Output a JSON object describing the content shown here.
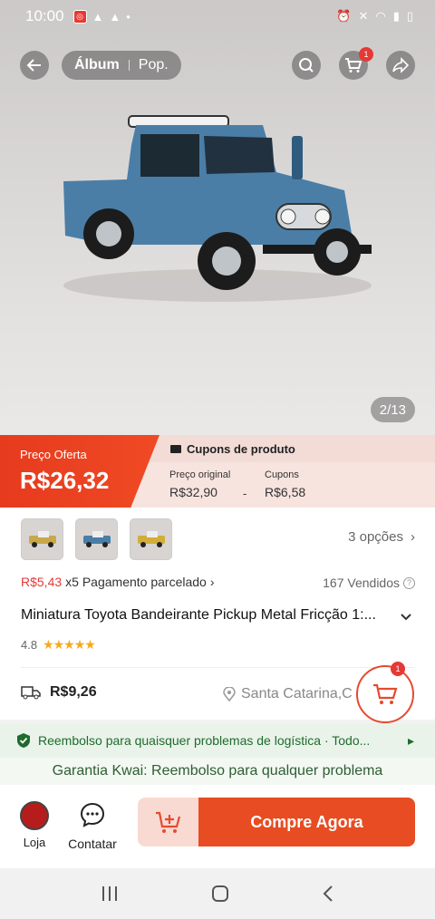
{
  "status_bar": {
    "time": "10:00"
  },
  "header": {
    "tabs": [
      {
        "label": "Álbum"
      },
      {
        "label": "Pop."
      }
    ],
    "cart_badge": "1",
    "image_counter": "2/13"
  },
  "price": {
    "offer_label": "Preço Oferta",
    "offer_value": "R$26,32",
    "coupons_title": "Cupons de produto",
    "original_label": "Preço original",
    "original_value": "R$32,90",
    "separator": "-",
    "coupon_label": "Cupons",
    "coupon_value": "R$6,58"
  },
  "product": {
    "options_label": "3 opções",
    "installment_amount": "R$5,43",
    "installment_text": "x5 Pagamento parcelado",
    "sold": "167 Vendidos",
    "title": "Miniatura Toyota Bandeirante Pickup Metal Fricção 1:...",
    "rating": "4.8",
    "stars": "★★★★★",
    "shipping_price": "R$9,26",
    "location": "Santa Catarina,C"
  },
  "float_cart_badge": "1",
  "guarantee": {
    "refund_text": "Reembolso para quaisquer problemas de logística · Todo...",
    "kwai_text": "Garantia Kwai: Reembolso para qualquer problema"
  },
  "actions": {
    "shop_label": "Loja",
    "contact_label": "Contatar",
    "buy_label": "Compre Agora"
  },
  "colors": {
    "accent": "#e74c22",
    "badge": "#e53935",
    "green": "#1f6b2e"
  }
}
